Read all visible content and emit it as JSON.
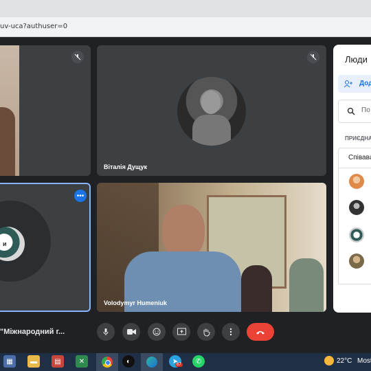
{
  "browser": {
    "url": "uv-uca?authuser=0"
  },
  "tiles": {
    "top_center_name": "Віталія Дущук",
    "bottom_right_name": "Volodymyr Humeniuk",
    "avatar_partial_text": "и"
  },
  "meeting": {
    "title": "\"Міжнародний г..."
  },
  "panel": {
    "title": "Люди",
    "add_label": "Дод",
    "search_placeholder": "По",
    "section_label": "ПРИЄДНА",
    "collaborators_label": "Співават"
  },
  "taskbar": {
    "weather_temp": "22°C",
    "weather_text": "Most",
    "badge": "67"
  },
  "colors": {
    "accent": "#8ab4f8",
    "end_call": "#ea4335",
    "panel_blue": "#1a73e8"
  },
  "icons": [
    "mic-off-icon",
    "more-icon",
    "mic-icon",
    "camera-icon",
    "emoji-icon",
    "present-icon",
    "raise-hand-icon",
    "more-vert-icon",
    "end-call-icon",
    "add-person-icon",
    "search-icon"
  ]
}
